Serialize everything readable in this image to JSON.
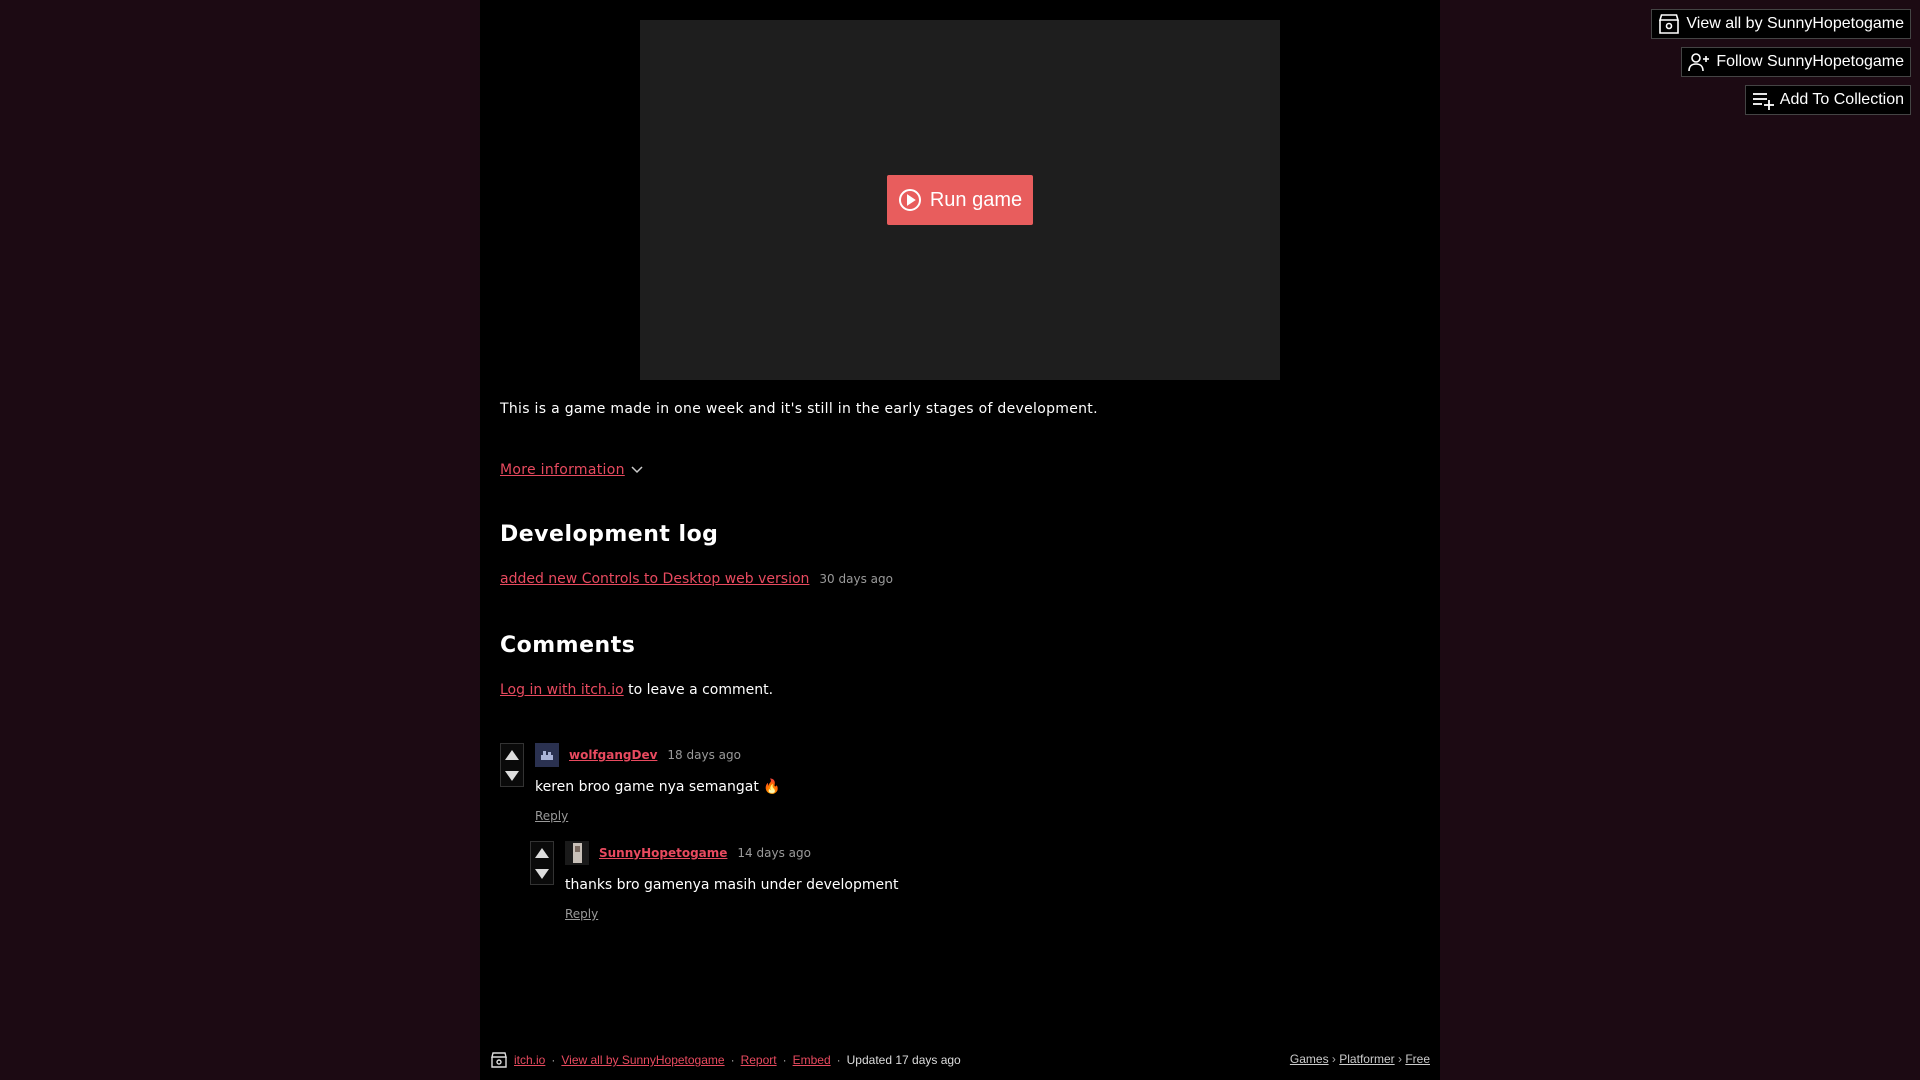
{
  "top_actions": {
    "view_all": "View all by SunnyHopetogame",
    "follow": "Follow SunnyHopetogame",
    "add_collection": "Add To Collection"
  },
  "embed": {
    "run_label": "Run game"
  },
  "description": "This is a game made in one week and it's still in the early stages of development.",
  "more_info": "More information",
  "devlog": {
    "heading": "Development log",
    "entries": [
      {
        "title": "added new Controls to Desktop web version",
        "date": "30 days ago"
      }
    ]
  },
  "comments": {
    "heading": "Comments",
    "login_link": "Log in with itch.io",
    "login_suffix": " to leave a comment.",
    "items": [
      {
        "author": "wolfgangDev",
        "date": "18 days ago",
        "body": "keren broo game nya semangat 🔥",
        "reply": "Reply"
      },
      {
        "author": "SunnyHopetogame",
        "date": "14 days ago",
        "body": "thanks bro gamenya masih under development",
        "reply": "Reply"
      }
    ]
  },
  "footer": {
    "site": "itch.io",
    "view_all": "View all by SunnyHopetogame",
    "report": "Report",
    "embed": "Embed",
    "updated": "Updated 17 days ago",
    "breadcrumbs": [
      "Games",
      "Platformer",
      "Free"
    ]
  },
  "colors": {
    "accent": "#e84a5f",
    "run_button": "#e85d5d",
    "page_bg": "#1c0a13",
    "column_bg": "#000000"
  }
}
